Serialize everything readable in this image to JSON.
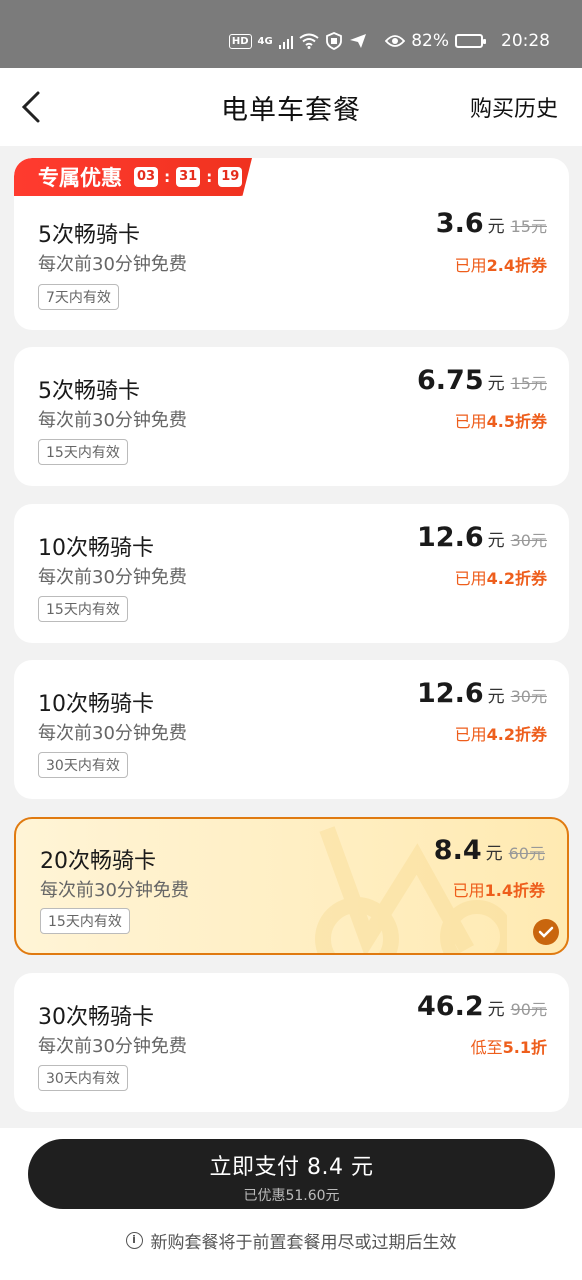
{
  "status_bar": {
    "hd": "HD",
    "network": "4G",
    "battery": "82%",
    "battery_level": 0.82,
    "time": "20:28"
  },
  "nav": {
    "title": "电单车套餐",
    "history_label": "购买历史"
  },
  "promo": {
    "label": "专属优惠",
    "countdown": [
      "03",
      "31",
      "19"
    ]
  },
  "packages": [
    {
      "name": "5次畅骑卡",
      "desc": "每次前30分钟免费",
      "validity": "7天内有效",
      "price": "3.6",
      "unit": "元",
      "original": "15元",
      "discount_prefix": "已用",
      "discount_value": "2.4折券"
    },
    {
      "name": "5次畅骑卡",
      "desc": "每次前30分钟免费",
      "validity": "15天内有效",
      "price": "6.75",
      "unit": "元",
      "original": "15元",
      "discount_prefix": "已用",
      "discount_value": "4.5折券"
    },
    {
      "name": "10次畅骑卡",
      "desc": "每次前30分钟免费",
      "validity": "15天内有效",
      "price": "12.6",
      "unit": "元",
      "original": "30元",
      "discount_prefix": "已用",
      "discount_value": "4.2折券"
    },
    {
      "name": "10次畅骑卡",
      "desc": "每次前30分钟免费",
      "validity": "30天内有效",
      "price": "12.6",
      "unit": "元",
      "original": "30元",
      "discount_prefix": "已用",
      "discount_value": "4.2折券"
    },
    {
      "name": "20次畅骑卡",
      "desc": "每次前30分钟免费",
      "validity": "15天内有效",
      "price": "8.4",
      "unit": "元",
      "original": "60元",
      "discount_prefix": "已用",
      "discount_value": "1.4折券"
    },
    {
      "name": "30次畅骑卡",
      "desc": "每次前30分钟免费",
      "validity": "30天内有效",
      "price": "46.2",
      "unit": "元",
      "original": "90元",
      "discount_prefix": "低至",
      "discount_value": "5.1折"
    }
  ],
  "pay": {
    "label": "立即支付 8.4 元",
    "saved": "已优惠51.60元"
  },
  "notice": "新购套餐将于前置套餐用尽或过期后生效",
  "colors": {
    "accent": "#e07a10",
    "discount": "#ee5e1c",
    "promo": "#f0321f",
    "pay_button": "#1f1f1f"
  }
}
